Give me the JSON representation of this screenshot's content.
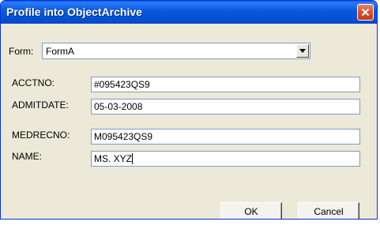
{
  "window": {
    "title": "Profile into ObjectArchive"
  },
  "form_selector": {
    "label": "Form:",
    "value": "FormA"
  },
  "fields": [
    {
      "label": "ACCTNO:",
      "value": "#095423QS9"
    },
    {
      "label": "ADMITDATE:",
      "value": "05-03-2008"
    },
    {
      "label": "MEDRECNO:",
      "value": "M095423QS9"
    },
    {
      "label": "NAME:",
      "value": "MS. XYZ"
    }
  ],
  "buttons": {
    "ok": "OK",
    "cancel": "Cancel"
  },
  "icons": {
    "close": "close-icon",
    "dropdown": "chevron-down-icon"
  },
  "colors": {
    "title_bar": "#0552d6",
    "window_face": "#ece9d8",
    "close_button": "#d9502e",
    "field_border": "#7f9db9"
  }
}
